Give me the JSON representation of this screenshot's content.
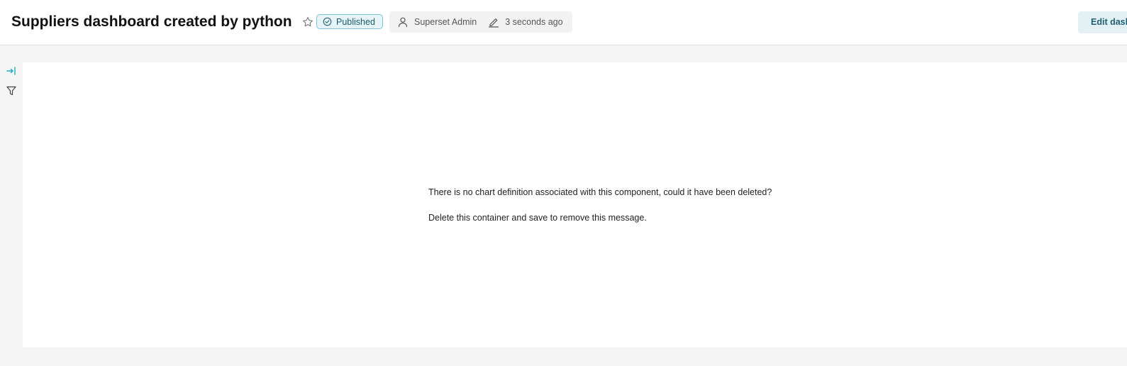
{
  "header": {
    "title": "Suppliers dashboard created by python",
    "status_badge": "Published",
    "owner": "Superset Admin",
    "modified": "3 seconds ago",
    "edit_button": "Edit dashboard",
    "accent_color": "#20a7c9"
  },
  "sidebar": {
    "icons": [
      "expand-icon",
      "filter-icon"
    ]
  },
  "panel": {
    "message_line1": "There is no chart definition associated with this component, could it have been deleted?",
    "message_line2": "Delete this container and save to remove this message."
  }
}
